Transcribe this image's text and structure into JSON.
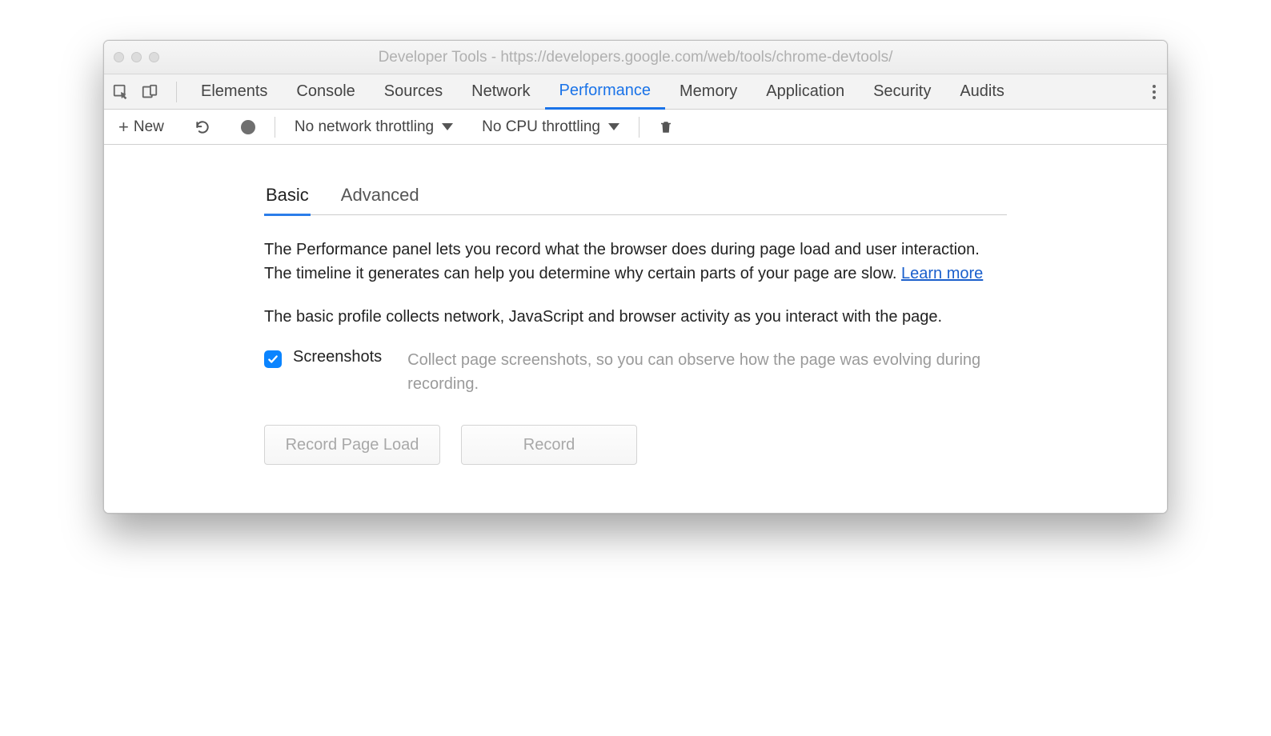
{
  "window": {
    "title": "Developer Tools - https://developers.google.com/web/tools/chrome-devtools/"
  },
  "tabs": {
    "items": [
      {
        "label": "Elements"
      },
      {
        "label": "Console"
      },
      {
        "label": "Sources"
      },
      {
        "label": "Network"
      },
      {
        "label": "Performance"
      },
      {
        "label": "Memory"
      },
      {
        "label": "Application"
      },
      {
        "label": "Security"
      },
      {
        "label": "Audits"
      }
    ],
    "active_index": 4
  },
  "toolbar": {
    "new_label": "New",
    "network_throttle": "No network throttling",
    "cpu_throttle": "No CPU throttling"
  },
  "subtabs": {
    "items": [
      {
        "label": "Basic"
      },
      {
        "label": "Advanced"
      }
    ],
    "active_index": 0
  },
  "body": {
    "intro_text": "The Performance panel lets you record what the browser does during page load and user interaction. The timeline it generates can help you determine why certain parts of your page are slow.  ",
    "learn_more": "Learn more",
    "basic_desc": "The basic profile collects network, JavaScript and browser activity as you interact with the page.",
    "screenshots_label": "Screenshots",
    "screenshots_desc": "Collect page screenshots, so you can observe how the page was evolving during recording.",
    "btn_record_page_load": "Record Page Load",
    "btn_record": "Record"
  }
}
